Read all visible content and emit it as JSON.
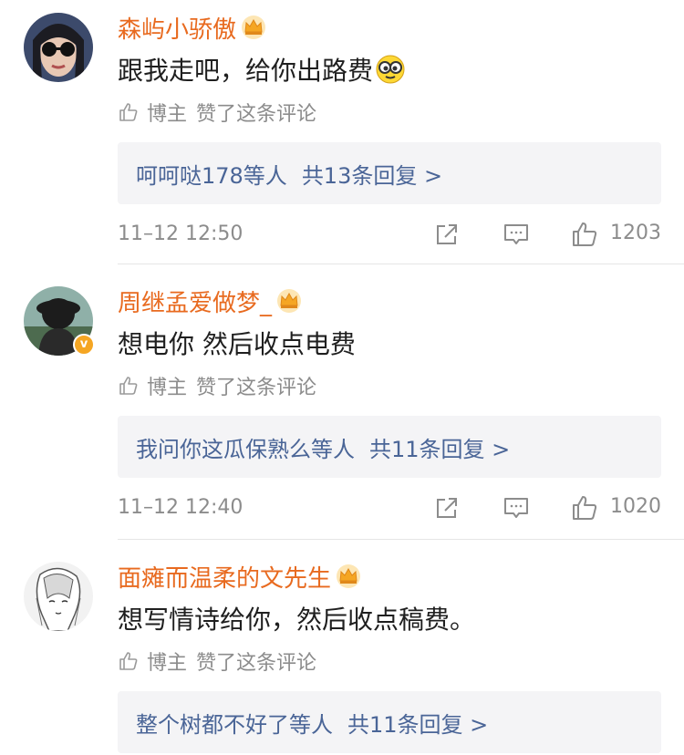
{
  "comments": [
    {
      "username": "森屿小骄傲",
      "text": "跟我走吧，给你出路费",
      "emoji": "sunglasses-emoji",
      "author_label": "博主",
      "liked_label": "赞了这条评论",
      "reply_preview": "呵呵哒178等人",
      "reply_count": "共13条回复 >",
      "timestamp": "11–12 12:50",
      "likes": "1203",
      "verified": false
    },
    {
      "username": "周继孟爱做梦_",
      "text": "想电你 然后收点电费",
      "author_label": "博主",
      "liked_label": "赞了这条评论",
      "reply_preview": "我问你这瓜保熟么等人",
      "reply_count": "共11条回复 >",
      "timestamp": "11–12 12:40",
      "likes": "1020",
      "verified": true
    },
    {
      "username": "面瘫而温柔的文先生",
      "text": "想写情诗给你，然后收点稿费。",
      "author_label": "博主",
      "liked_label": "赞了这条评论",
      "reply_preview": "整个树都不好了等人",
      "reply_count": "共11条回复 >",
      "verified": false
    }
  ],
  "colors": {
    "username": "#e86a1f",
    "link": "#4a6597",
    "meta": "#8c8c8c",
    "reply_bg": "#f4f4f6",
    "crown": "#f5a623"
  },
  "icons": [
    "crown-icon",
    "thumb-up-icon",
    "share-icon",
    "comment-icon",
    "verified-icon"
  ]
}
